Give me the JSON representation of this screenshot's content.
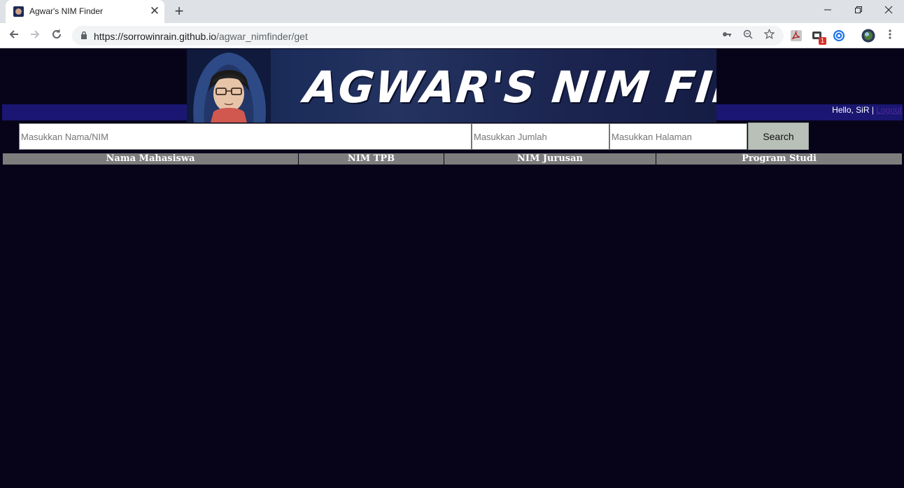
{
  "browser": {
    "tab_title": "Agwar's NIM Finder",
    "tab_close": "✕",
    "new_tab": "+",
    "url_host": "https://sorrowinrain.github.io",
    "url_path": "/agwar_nimfinder/get",
    "extension_badge": "1",
    "icons": [
      "back-icon",
      "forward-icon",
      "reload-icon",
      "lock-icon",
      "key-icon",
      "zoom-icon",
      "star-icon",
      "pdf-icon",
      "extension-icon",
      "sync-icon",
      "profile-icon",
      "menu-icon"
    ]
  },
  "header": {
    "banner_title": "AGWAR'S NIM FINDER",
    "greeting": "Hello, SiR | ",
    "logout": "Logout"
  },
  "search": {
    "name_placeholder": "Masukkan Nama/NIM",
    "count_placeholder": "Masukkan Jumlah",
    "page_placeholder": "Masukkan Halaman",
    "button_label": "Search"
  },
  "table": {
    "columns": [
      "Nama Mahasiswa",
      "NIM TPB",
      "NIM Jurusan",
      "Program Studi"
    ]
  },
  "colors": {
    "page_bg": "#07041a",
    "header_bar": "#1a1671",
    "table_header": "#7d7d7d",
    "button_bg": "#b9c0b8"
  }
}
